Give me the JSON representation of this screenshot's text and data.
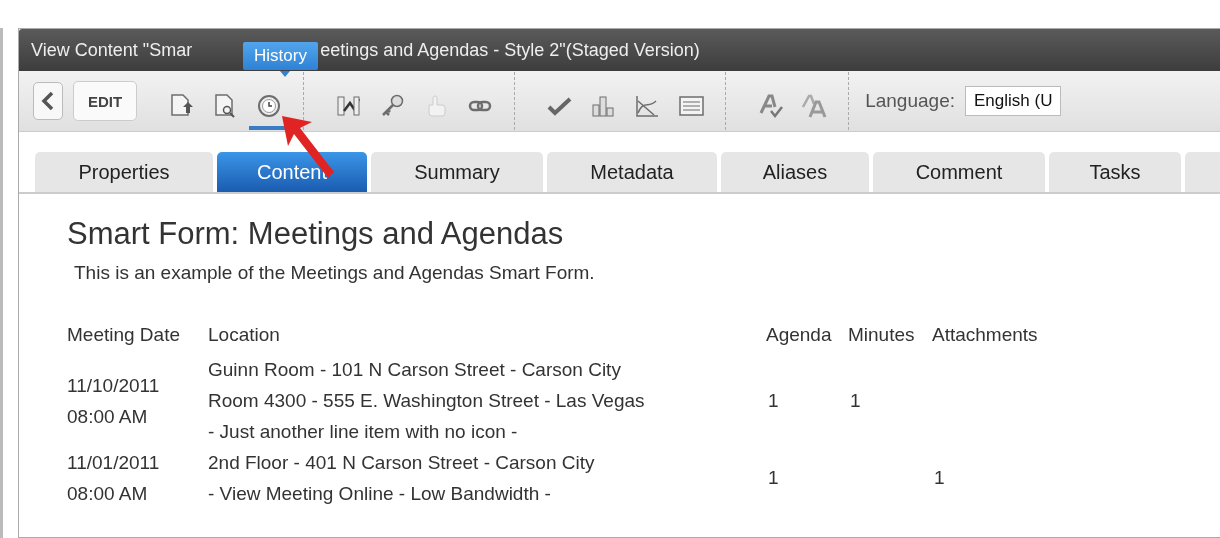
{
  "window": {
    "title_before": "View Content \"Smar",
    "title_after": "eetings and Agendas - Style 2\"(Staged Version)"
  },
  "tooltip": {
    "text": "History"
  },
  "toolbar": {
    "edit_label": "EDIT",
    "groups": [
      [
        {
          "selected": false
        },
        {
          "selected": false
        },
        {
          "selected": true
        }
      ],
      [
        {
          "selected": false
        },
        {
          "selected": false
        },
        {
          "selected": false
        },
        {
          "selected": false
        }
      ],
      [
        {
          "selected": false
        },
        {
          "selected": false
        },
        {
          "selected": false
        },
        {
          "selected": false
        }
      ],
      [
        {
          "selected": false
        },
        {
          "selected": false
        }
      ]
    ],
    "language_label": "Language:",
    "language_value": "English (U"
  },
  "tabs": [
    {
      "label": "Properties",
      "selected": false
    },
    {
      "label": "Content",
      "selected": true
    },
    {
      "label": "Summary",
      "selected": false
    },
    {
      "label": "Metadata",
      "selected": false
    },
    {
      "label": "Aliases",
      "selected": false
    },
    {
      "label": "Comment",
      "selected": false
    },
    {
      "label": "Tasks",
      "selected": false
    }
  ],
  "content": {
    "heading": "Smart Form: Meetings and Agendas",
    "description": "This is an example of the Meetings and Agendas Smart Form.",
    "table": {
      "columns": [
        "Meeting Date",
        "Location",
        "Agenda",
        "Minutes",
        "Attachments"
      ],
      "rows": [
        {
          "date": "11/10/2011",
          "time": "08:00 AM",
          "locations": [
            "Guinn Room - 101 N Carson Street - Carson City",
            "Room 4300 - 555 E. Washington Street - Las Vegas",
            "- Just another line item with no icon -"
          ],
          "agenda": "1",
          "minutes": "1"
        },
        {
          "date": "11/01/2011",
          "time": "08:00 AM",
          "locations": [
            "2nd Floor - 401 N Carson Street - Carson City",
            "- View Meeting Online - Low Bandwidth -"
          ],
          "agenda": "1",
          "attachments": "1"
        }
      ]
    }
  }
}
